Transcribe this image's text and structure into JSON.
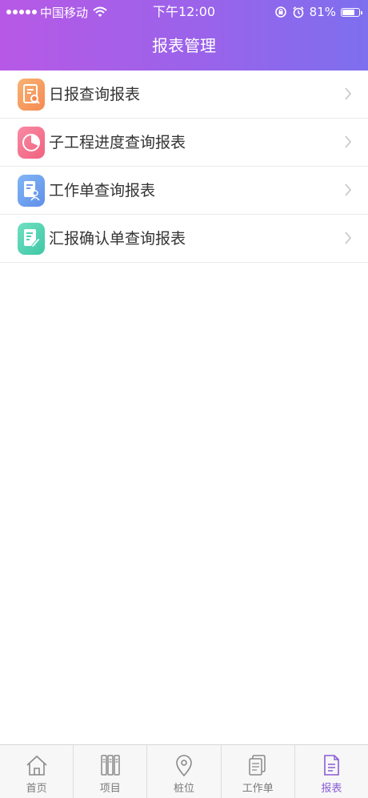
{
  "status_bar": {
    "carrier": "中国移动",
    "time": "下午12:00",
    "battery_percent": "81%",
    "battery_level": 0.81
  },
  "nav": {
    "title": "报表管理"
  },
  "menu": [
    {
      "label": "日报查询报表",
      "icon": "daily-report-icon",
      "color": "#f59a5e"
    },
    {
      "label": "子工程进度查询报表",
      "icon": "pie-chart-icon",
      "color": "#f4708e"
    },
    {
      "label": "工作单查询报表",
      "icon": "work-order-person-icon",
      "color": "#6fa2f0"
    },
    {
      "label": "汇报确认单查询报表",
      "icon": "document-edit-icon",
      "color": "#4fd1b3"
    }
  ],
  "tabs": [
    {
      "label": "首页",
      "icon": "home-icon",
      "active": false
    },
    {
      "label": "项目",
      "icon": "binders-icon",
      "active": false
    },
    {
      "label": "桩位",
      "icon": "location-pin-icon",
      "active": false
    },
    {
      "label": "工作单",
      "icon": "documents-icon",
      "active": false
    },
    {
      "label": "报表",
      "icon": "report-icon",
      "active": true
    }
  ],
  "colors": {
    "header_gradient_start": "#b759e6",
    "header_gradient_end": "#7d6fee",
    "active_tab": "#8a5cd8",
    "inactive_tab": "#7a7a7a"
  }
}
